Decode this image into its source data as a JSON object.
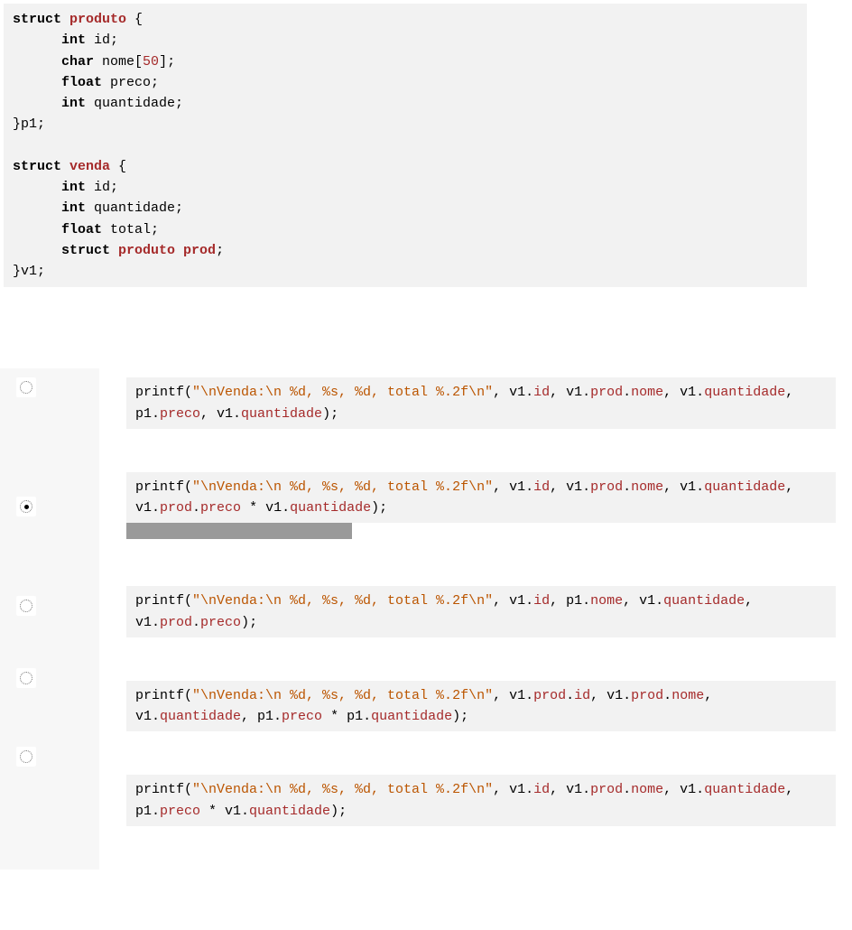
{
  "structCode": {
    "l1a": "struct ",
    "l1b": "produto",
    "l1c": " {",
    "l2a": "      ",
    "l2b": "int",
    "l2c": " id;",
    "l3a": "      ",
    "l3b": "char",
    "l3c": " nome[",
    "l3d": "50",
    "l3e": "];",
    "l4a": "      ",
    "l4b": "float",
    "l4c": " preco;",
    "l5a": "      ",
    "l5b": "int",
    "l5c": " quantidade;",
    "l6": "}p1;",
    "blank": "",
    "l7a": "struct ",
    "l7b": "venda",
    "l7c": " {",
    "l8a": "      ",
    "l8b": "int",
    "l8c": " id;",
    "l9a": "      ",
    "l9b": "int",
    "l9c": " quantidade;",
    "l10a": "      ",
    "l10b": "float",
    "l10c": " total;",
    "l11a": "      ",
    "l11b": "struct ",
    "l11c": "produto prod",
    "l11d": ";",
    "l12": "}v1;"
  },
  "options": [
    {
      "selected": false,
      "hasRedact": false,
      "segs": [
        {
          "t": "printf(",
          "c": ""
        },
        {
          "t": "\"\\nVenda:\\n %d, %s, %d, total %.2f\\n\"",
          "c": "str"
        },
        {
          "t": ", v1.",
          "c": ""
        },
        {
          "t": "id",
          "c": "member"
        },
        {
          "t": ", v1.",
          "c": ""
        },
        {
          "t": "prod",
          "c": "member"
        },
        {
          "t": ".",
          "c": ""
        },
        {
          "t": "nome",
          "c": "member"
        },
        {
          "t": ", v1.",
          "c": ""
        },
        {
          "t": "quantidade",
          "c": "member"
        },
        {
          "t": ", p1.",
          "c": ""
        },
        {
          "t": "preco",
          "c": "member"
        },
        {
          "t": ", v1.",
          "c": ""
        },
        {
          "t": "quantidade",
          "c": "member"
        },
        {
          "t": ");",
          "c": ""
        }
      ]
    },
    {
      "selected": true,
      "hasRedact": true,
      "segs": [
        {
          "t": "printf(",
          "c": ""
        },
        {
          "t": "\"\\nVenda:\\n %d, %s, %d, total %.2f\\n\"",
          "c": "str"
        },
        {
          "t": ", v1.",
          "c": ""
        },
        {
          "t": "id",
          "c": "member"
        },
        {
          "t": ", v1.",
          "c": ""
        },
        {
          "t": "prod",
          "c": "member"
        },
        {
          "t": ".",
          "c": ""
        },
        {
          "t": "nome",
          "c": "member"
        },
        {
          "t": ", v1.",
          "c": ""
        },
        {
          "t": "quantidade",
          "c": "member"
        },
        {
          "t": ", v1.",
          "c": ""
        },
        {
          "t": "prod",
          "c": "member"
        },
        {
          "t": ".",
          "c": ""
        },
        {
          "t": "preco",
          "c": "member"
        },
        {
          "t": " * v1.",
          "c": ""
        },
        {
          "t": "quantidade",
          "c": "member"
        },
        {
          "t": ");",
          "c": ""
        }
      ]
    },
    {
      "selected": false,
      "hasRedact": false,
      "segs": [
        {
          "t": "printf(",
          "c": ""
        },
        {
          "t": "\"\\nVenda:\\n %d, %s, %d, total %.2f\\n\"",
          "c": "str"
        },
        {
          "t": ", v1.",
          "c": ""
        },
        {
          "t": "id",
          "c": "member"
        },
        {
          "t": ", p1.",
          "c": ""
        },
        {
          "t": "nome",
          "c": "member"
        },
        {
          "t": ", v1.",
          "c": ""
        },
        {
          "t": "quantidade",
          "c": "member"
        },
        {
          "t": ", v1.",
          "c": ""
        },
        {
          "t": "prod",
          "c": "member"
        },
        {
          "t": ".",
          "c": ""
        },
        {
          "t": "preco",
          "c": "member"
        },
        {
          "t": ");",
          "c": ""
        }
      ]
    },
    {
      "selected": false,
      "hasRedact": false,
      "segs": [
        {
          "t": "printf(",
          "c": ""
        },
        {
          "t": "\"\\nVenda:\\n %d, %s, %d, total %.2f\\n\"",
          "c": "str"
        },
        {
          "t": ", v1.",
          "c": ""
        },
        {
          "t": "prod",
          "c": "member"
        },
        {
          "t": ".",
          "c": ""
        },
        {
          "t": "id",
          "c": "member"
        },
        {
          "t": ", v1.",
          "c": ""
        },
        {
          "t": "prod",
          "c": "member"
        },
        {
          "t": ".",
          "c": ""
        },
        {
          "t": "nome",
          "c": "member"
        },
        {
          "t": ", v1.",
          "c": ""
        },
        {
          "t": "quantidade",
          "c": "member"
        },
        {
          "t": ", p1.",
          "c": ""
        },
        {
          "t": "preco",
          "c": "member"
        },
        {
          "t": " * p1.",
          "c": ""
        },
        {
          "t": "quantidade",
          "c": "member"
        },
        {
          "t": ");",
          "c": ""
        }
      ]
    },
    {
      "selected": false,
      "hasRedact": false,
      "segs": [
        {
          "t": "printf(",
          "c": ""
        },
        {
          "t": "\"\\nVenda:\\n %d, %s, %d, total %.2f\\n\"",
          "c": "str"
        },
        {
          "t": ", v1.",
          "c": ""
        },
        {
          "t": "id",
          "c": "member"
        },
        {
          "t": ", v1.",
          "c": ""
        },
        {
          "t": "prod",
          "c": "member"
        },
        {
          "t": ".",
          "c": ""
        },
        {
          "t": "nome",
          "c": "member"
        },
        {
          "t": ", v1.",
          "c": ""
        },
        {
          "t": "quantidade",
          "c": "member"
        },
        {
          "t": ", p1.",
          "c": ""
        },
        {
          "t": "preco",
          "c": "member"
        },
        {
          "t": " * v1.",
          "c": ""
        },
        {
          "t": "quantidade",
          "c": "member"
        },
        {
          "t": ");",
          "c": ""
        }
      ]
    }
  ]
}
